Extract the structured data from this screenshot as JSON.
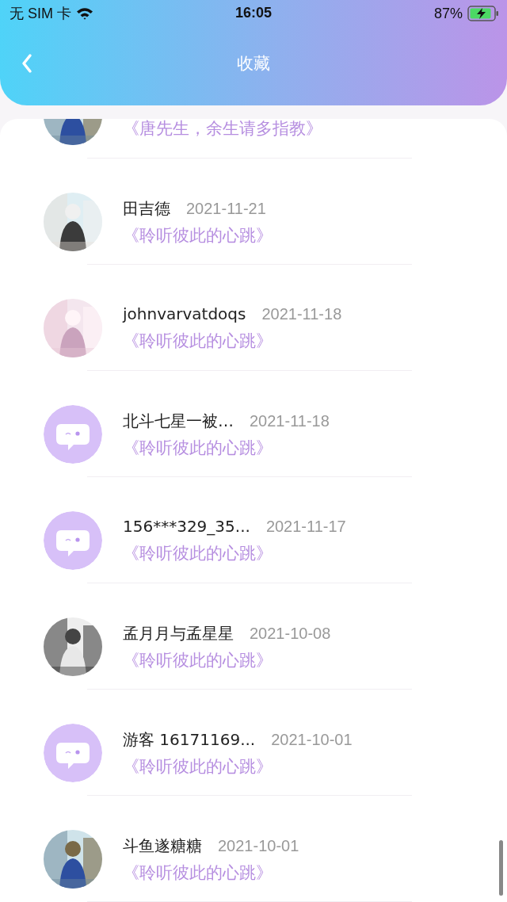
{
  "status_bar": {
    "carrier": "无 SIM 卡",
    "time": "16:05",
    "battery": "87%",
    "charging": true
  },
  "header": {
    "title": "收藏"
  },
  "favorites": [
    {
      "title": "《唐先生，余生请多指教》"
    },
    {
      "name": "田吉德",
      "date": "2021-11-21",
      "title": "《聆听彼此的心跳》"
    },
    {
      "name": "johnvarvatdoqs",
      "date": "2021-11-18",
      "title": "《聆听彼此的心跳》"
    },
    {
      "kind": "default",
      "name": "北斗七星一被…",
      "date": "2021-11-18",
      "title": "《聆听彼此的心跳》"
    },
    {
      "kind": "default",
      "name": "156***329_35...",
      "date": "2021-11-17",
      "title": "《聆听彼此的心跳》"
    },
    {
      "name": "孟月月与孟星星",
      "date": "2021-10-08",
      "title": "《聆听彼此的心跳》"
    },
    {
      "kind": "default",
      "name": "游客 16171169...",
      "date": "2021-10-01",
      "title": "《聆听彼此的心跳》"
    },
    {
      "name": "斗鱼遂糖糖",
      "date": "2021-10-01",
      "title": "《聆听彼此的心跳》"
    }
  ]
}
